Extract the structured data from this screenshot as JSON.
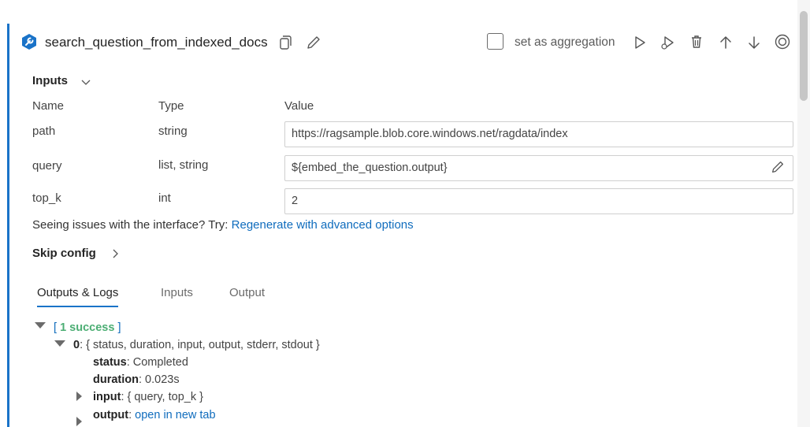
{
  "node": {
    "title": "search_question_from_indexed_docs",
    "aggregation_label": "set as aggregation",
    "aggregation_checked": false,
    "accent_color": "#1a73c8",
    "icons": [
      "wrench-icon",
      "copy-icon",
      "edit-icon",
      "run-icon",
      "debug-icon",
      "delete-icon",
      "move-up-icon",
      "move-down-icon",
      "target-icon"
    ]
  },
  "inputs": {
    "section_label": "Inputs",
    "headers": {
      "name": "Name",
      "type": "Type",
      "value": "Value"
    },
    "rows": [
      {
        "name": "path",
        "type": "string",
        "value": "https://ragsample.blob.core.windows.net/ragdata/index"
      },
      {
        "name": "query",
        "type": "list, string",
        "value": "${embed_the_question.output}"
      },
      {
        "name": "top_k",
        "type": "int",
        "value": "2"
      }
    ],
    "issues_text": "Seeing issues with the interface? Try: ",
    "issues_link": "Regenerate with advanced options"
  },
  "skip_config": {
    "label": "Skip config"
  },
  "tabs": [
    {
      "label": "Outputs & Logs",
      "active": true
    },
    {
      "label": "Inputs",
      "active": false
    },
    {
      "label": "Output",
      "active": false
    }
  ],
  "tree": {
    "open_bracket": "[",
    "success_count": "1 success",
    "close_bracket": "]",
    "item_index": "0",
    "item_summary": ": { status, duration, input, output, stderr, stdout }",
    "status_key": "status",
    "status_value": ": Completed",
    "duration_key": "duration",
    "duration_value": ": 0.023s",
    "input_key": "input",
    "input_value": ": { query, top_k }",
    "output_key": "output",
    "output_sep": ": ",
    "output_link": "open in new tab"
  }
}
